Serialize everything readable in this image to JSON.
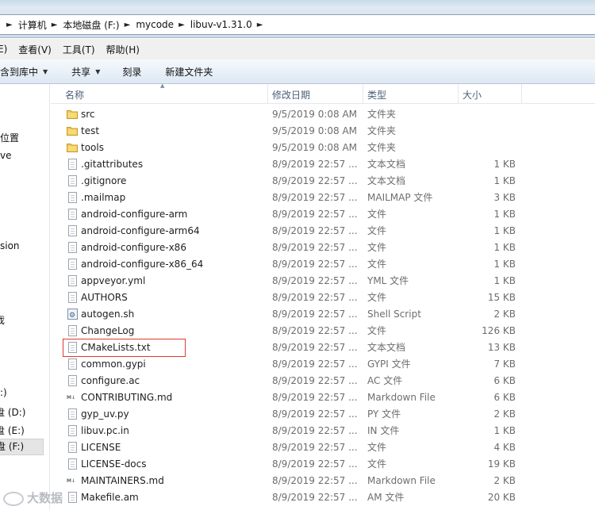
{
  "breadcrumb": [
    {
      "label": "计算机"
    },
    {
      "label": "本地磁盘 (F:)"
    },
    {
      "label": "mycode"
    },
    {
      "label": "libuv-v1.31.0"
    }
  ],
  "menu": [
    "E)",
    "查看(V)",
    "工具(T)",
    "帮助(H)"
  ],
  "toolbar": {
    "include_label": "包含到库中",
    "share_label": "共享",
    "burn_label": "刻录",
    "new_folder_label": "新建文件夹"
  },
  "nav": [
    {
      "label": "的位置"
    },
    {
      "label": "ve"
    },
    {
      "label": "sion"
    },
    {
      "label": "戏"
    },
    {
      "label": ":)"
    },
    {
      "label": "盘 (D:)"
    },
    {
      "label": "盘 (E:)"
    },
    {
      "label": "盘 (F:)"
    }
  ],
  "columns": {
    "name": "名称",
    "date": "修改日期",
    "type": "类型",
    "size": "大小"
  },
  "files": [
    {
      "name": "src",
      "date": "9/5/2019 0:08 AM",
      "type": "文件夹",
      "size": "",
      "icon": "folder-icon"
    },
    {
      "name": "test",
      "date": "9/5/2019 0:08 AM",
      "type": "文件夹",
      "size": "",
      "icon": "folder-icon"
    },
    {
      "name": "tools",
      "date": "9/5/2019 0:08 AM",
      "type": "文件夹",
      "size": "",
      "icon": "folder-icon"
    },
    {
      "name": ".gitattributes",
      "date": "8/9/2019 22:57 ...",
      "type": "文本文档",
      "size": "1 KB",
      "icon": "text-file-icon"
    },
    {
      "name": ".gitignore",
      "date": "8/9/2019 22:57 ...",
      "type": "文本文档",
      "size": "1 KB",
      "icon": "text-file-icon"
    },
    {
      "name": ".mailmap",
      "date": "8/9/2019 22:57 ...",
      "type": "MAILMAP 文件",
      "size": "3 KB",
      "icon": "file-icon"
    },
    {
      "name": "android-configure-arm",
      "date": "8/9/2019 22:57 ...",
      "type": "文件",
      "size": "1 KB",
      "icon": "file-icon"
    },
    {
      "name": "android-configure-arm64",
      "date": "8/9/2019 22:57 ...",
      "type": "文件",
      "size": "1 KB",
      "icon": "file-icon"
    },
    {
      "name": "android-configure-x86",
      "date": "8/9/2019 22:57 ...",
      "type": "文件",
      "size": "1 KB",
      "icon": "file-icon"
    },
    {
      "name": "android-configure-x86_64",
      "date": "8/9/2019 22:57 ...",
      "type": "文件",
      "size": "1 KB",
      "icon": "file-icon"
    },
    {
      "name": "appveyor.yml",
      "date": "8/9/2019 22:57 ...",
      "type": "YML 文件",
      "size": "1 KB",
      "icon": "file-icon"
    },
    {
      "name": "AUTHORS",
      "date": "8/9/2019 22:57 ...",
      "type": "文件",
      "size": "15 KB",
      "icon": "file-icon"
    },
    {
      "name": "autogen.sh",
      "date": "8/9/2019 22:57 ...",
      "type": "Shell Script",
      "size": "2 KB",
      "icon": "shell-script-icon"
    },
    {
      "name": "ChangeLog",
      "date": "8/9/2019 22:57 ...",
      "type": "文件",
      "size": "126 KB",
      "icon": "file-icon"
    },
    {
      "name": "CMakeLists.txt",
      "date": "8/9/2019 22:57 ...",
      "type": "文本文档",
      "size": "13 KB",
      "icon": "text-file-icon"
    },
    {
      "name": "common.gypi",
      "date": "8/9/2019 22:57 ...",
      "type": "GYPI 文件",
      "size": "7 KB",
      "icon": "file-icon"
    },
    {
      "name": "configure.ac",
      "date": "8/9/2019 22:57 ...",
      "type": "AC 文件",
      "size": "6 KB",
      "icon": "file-icon"
    },
    {
      "name": "CONTRIBUTING.md",
      "date": "8/9/2019 22:57 ...",
      "type": "Markdown File",
      "size": "6 KB",
      "icon": "markdown-icon"
    },
    {
      "name": "gyp_uv.py",
      "date": "8/9/2019 22:57 ...",
      "type": "PY 文件",
      "size": "2 KB",
      "icon": "file-icon"
    },
    {
      "name": "libuv.pc.in",
      "date": "8/9/2019 22:57 ...",
      "type": "IN 文件",
      "size": "1 KB",
      "icon": "file-icon"
    },
    {
      "name": "LICENSE",
      "date": "8/9/2019 22:57 ...",
      "type": "文件",
      "size": "4 KB",
      "icon": "file-icon"
    },
    {
      "name": "LICENSE-docs",
      "date": "8/9/2019 22:57 ...",
      "type": "文件",
      "size": "19 KB",
      "icon": "file-icon"
    },
    {
      "name": "MAINTAINERS.md",
      "date": "8/9/2019 22:57 ...",
      "type": "Markdown File",
      "size": "2 KB",
      "icon": "markdown-icon"
    },
    {
      "name": "Makefile.am",
      "date": "8/9/2019 22:57 ...",
      "type": "AM 文件",
      "size": "20 KB",
      "icon": "file-icon"
    }
  ],
  "watermark": "大数据",
  "colors": {
    "highlight": "#e03a2e",
    "folder": "#f2c94c"
  }
}
